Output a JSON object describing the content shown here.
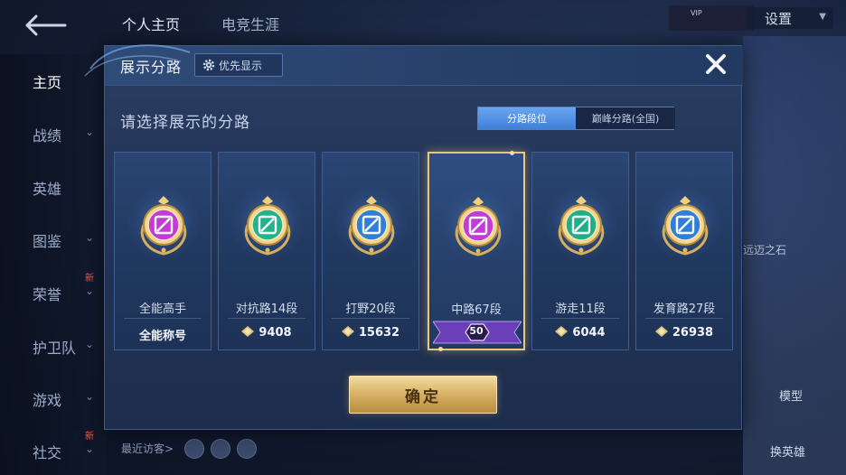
{
  "background": {
    "top_nav": [
      "个人主页",
      "电竞生涯"
    ],
    "settings_label": "设置",
    "vip_label": "VIP",
    "sidebar": [
      {
        "label": "主页",
        "active": true,
        "chevron": false,
        "new": false
      },
      {
        "label": "战绩",
        "active": false,
        "chevron": true,
        "new": false
      },
      {
        "label": "英雄",
        "active": false,
        "chevron": false,
        "new": false
      },
      {
        "label": "图鉴",
        "active": false,
        "chevron": true,
        "new": false
      },
      {
        "label": "荣誉",
        "active": false,
        "chevron": true,
        "new": true
      },
      {
        "label": "护卫队",
        "active": false,
        "chevron": true,
        "new": false
      },
      {
        "label": "游戏",
        "active": false,
        "chevron": true,
        "new": false
      },
      {
        "label": "社交",
        "active": false,
        "chevron": true,
        "new": true
      }
    ],
    "new_badge": "新",
    "right_text_1": "远迈之石",
    "right_text_2": "模型",
    "right_text_3": "换英雄",
    "recent_visitors_label": "最近访客>"
  },
  "dialog": {
    "title": "展示分路",
    "priority_button": "优先显示",
    "subtitle": "请选择展示的分路",
    "tabs": [
      {
        "label": "分路段位",
        "active": true
      },
      {
        "label": "巅峰分路(全国)",
        "active": false
      }
    ],
    "cards": [
      {
        "name": "全能高手",
        "value": "全能称号",
        "show_diamond": false,
        "selected": false,
        "emblem_color": "#c23bd6",
        "emblem_icon": "all-round-emblem-icon"
      },
      {
        "name": "对抗路14段",
        "value": "9408",
        "show_diamond": true,
        "selected": false,
        "emblem_color": "#22b38a",
        "emblem_icon": "clash-lane-emblem-icon"
      },
      {
        "name": "打野20段",
        "value": "15632",
        "show_diamond": true,
        "selected": false,
        "emblem_color": "#2f7ed8",
        "emblem_icon": "jungle-emblem-icon"
      },
      {
        "name": "中路67段",
        "value": "50",
        "show_diamond": false,
        "selected": true,
        "emblem_color": "#c23bd6",
        "emblem_icon": "mid-lane-emblem-icon"
      },
      {
        "name": "游走11段",
        "value": "6044",
        "show_diamond": true,
        "selected": false,
        "emblem_color": "#1fae86",
        "emblem_icon": "roam-emblem-icon"
      },
      {
        "name": "发育路27段",
        "value": "26938",
        "show_diamond": true,
        "selected": false,
        "emblem_color": "#2f7ed8",
        "emblem_icon": "farm-lane-emblem-icon"
      }
    ],
    "confirm_button": "确定",
    "colors": {
      "gold": "#e9c77c",
      "tab_active": "#3e7fd8",
      "dialog_bg": "#223457"
    }
  }
}
